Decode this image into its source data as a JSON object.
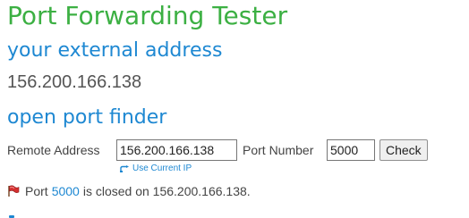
{
  "page": {
    "title": "Port Forwarding Tester"
  },
  "external": {
    "heading": "your external address",
    "ip": "156.200.166.138"
  },
  "finder": {
    "heading": "open port finder",
    "remote_label": "Remote Address",
    "remote_value": "156.200.166.138",
    "port_label": "Port Number",
    "port_value": "5000",
    "check_label": "Check",
    "use_current_label": "Use Current IP"
  },
  "result": {
    "prefix": "Port",
    "port": "5000",
    "suffix": "is closed on 156.200.166.138.",
    "icon": "red-flag-icon"
  },
  "colors": {
    "title": "#3cb043",
    "heading": "#1e88d2",
    "link": "#1e88d2",
    "flag": "#d32f2f"
  }
}
